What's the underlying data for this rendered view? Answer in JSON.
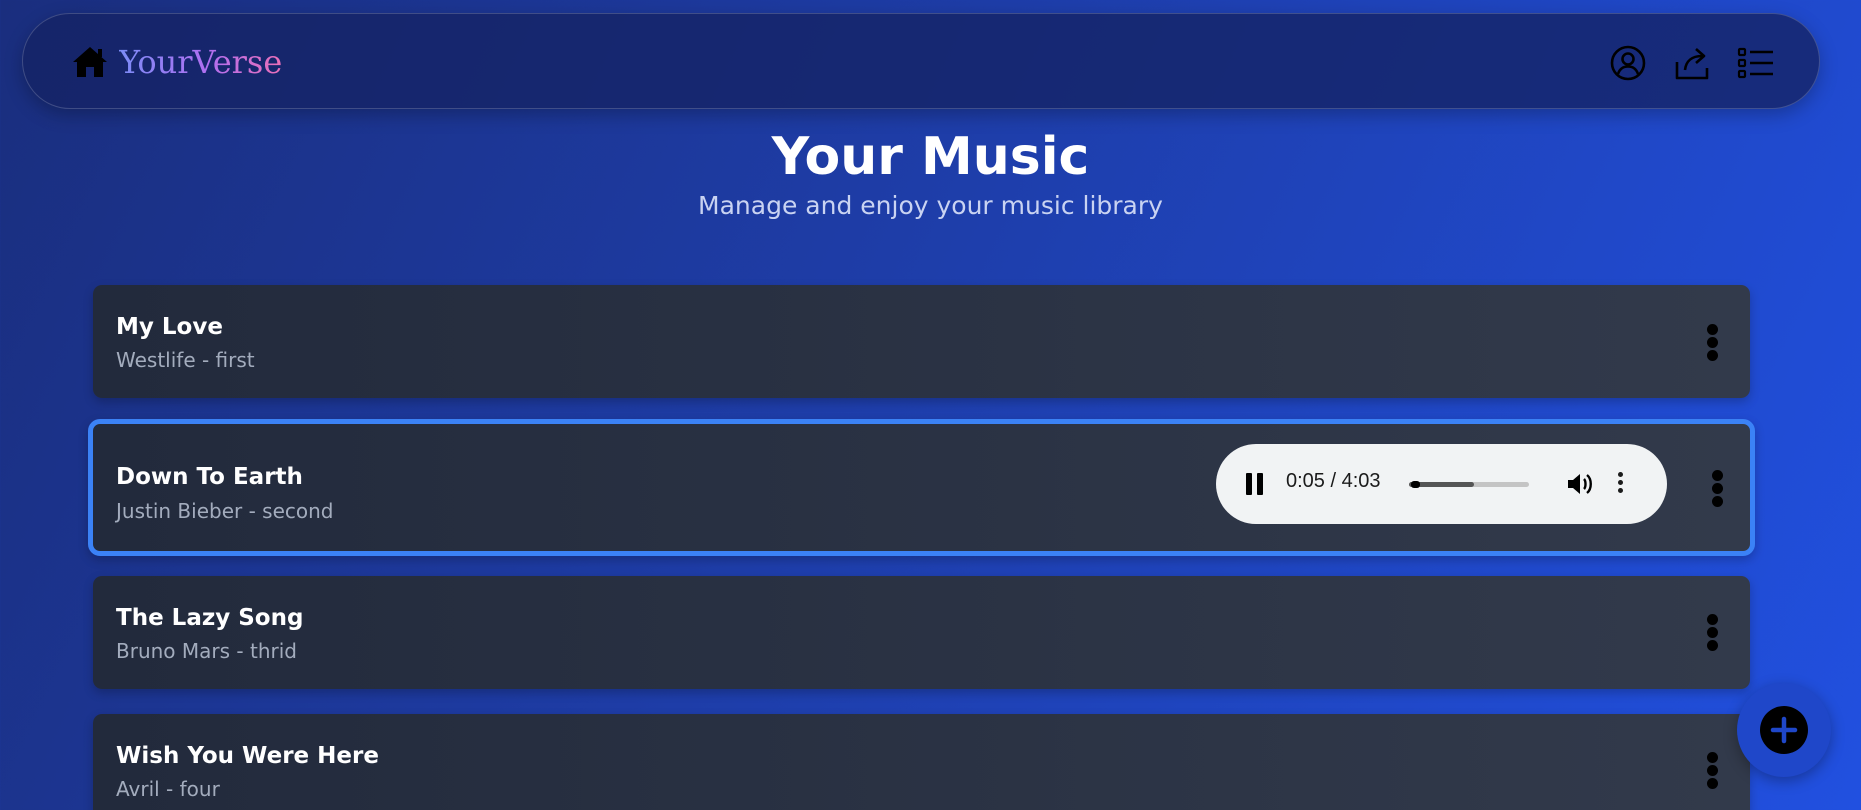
{
  "app": {
    "brand": "YourVerse"
  },
  "header": {
    "title": "Your Music",
    "subtitle": "Manage and enjoy your music library"
  },
  "songs": [
    {
      "title": "My Love",
      "meta": "Westlife - first",
      "active": false
    },
    {
      "title": "Down To Earth",
      "meta": "Justin Bieber - second",
      "active": true
    },
    {
      "title": "The Lazy Song",
      "meta": "Bruno Mars - thrid",
      "active": false
    },
    {
      "title": "Wish You Were Here",
      "meta": "Avril - four",
      "active": false
    }
  ],
  "player": {
    "time": "0:05 / 4:03",
    "progress": 0.02,
    "buffered": 0.54
  },
  "icons": {
    "home": "home-icon",
    "profile": "user-circle-icon",
    "share": "share-icon",
    "list": "list-icon",
    "add": "plus-icon"
  },
  "colors": {
    "accent": "#3b82f6",
    "card": "#2a3244",
    "background_start": "#1a2e7e",
    "background_end": "#2150e0"
  }
}
